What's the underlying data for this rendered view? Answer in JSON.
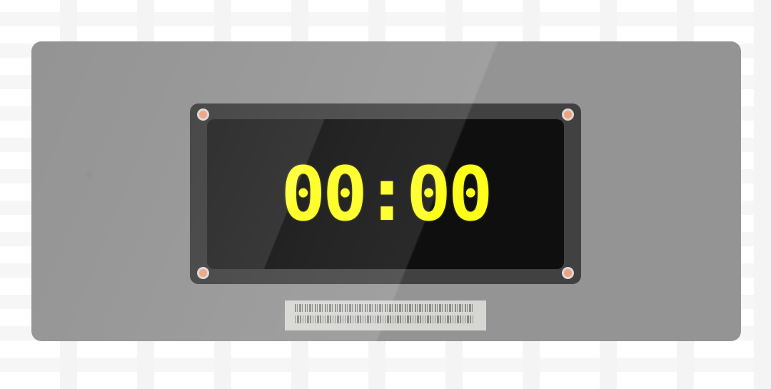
{
  "display": {
    "time": "00:00",
    "digit_color": "#ffff1c",
    "screen_color": "#0f0f0f",
    "bezel_color": "#414141",
    "panel_color": "#949494"
  },
  "screws": {
    "color": "#f0a27e",
    "count": 4
  },
  "label_plate": {
    "content": "barcode-pattern"
  }
}
